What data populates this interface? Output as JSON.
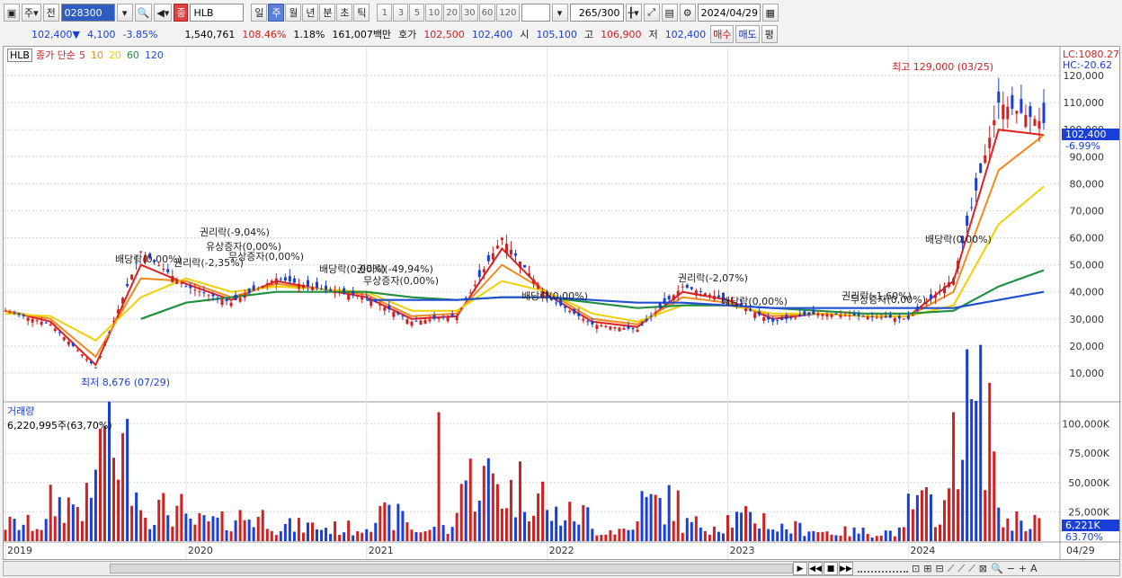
{
  "toolbar": {
    "type_label": "주",
    "prev_label": "전",
    "code": "028300",
    "name": "HLB",
    "periods": [
      "일",
      "주",
      "월",
      "년",
      "분",
      "초",
      "틱"
    ],
    "active_period": "주",
    "intervals": [
      "1",
      "3",
      "5",
      "10",
      "20",
      "30",
      "60",
      "120"
    ],
    "count": "265",
    "count_total": "/300",
    "date": "2024/04/29"
  },
  "quote": {
    "price": "102,400",
    "arrow": "▼",
    "change": "4,100",
    "change_pct": "-3.85%",
    "volume": "1,540,761",
    "turnover_pct": "108.46%",
    "rate": "1.18%",
    "amount": "161,007백만",
    "ask_label": "호가",
    "ask": "102,500",
    "bid": "102,400",
    "open_label": "시",
    "open": "105,100",
    "high_label": "고",
    "high": "106,900",
    "low_label": "저",
    "low": "102,400",
    "buy_label": "매수",
    "sell_label": "매도",
    "eval_label": "평"
  },
  "legend": {
    "stock": "HLB",
    "title": "종가 단순",
    "ma": [
      "5",
      "10",
      "20",
      "60",
      "120"
    ],
    "colors": [
      "#e02020",
      "#f08a1c",
      "#f0d000",
      "#209040",
      "#2050d0"
    ]
  },
  "scale_labels": {
    "lc": "LC:1080.27",
    "hc": "HC:-20.62",
    "price_tag": "102,400",
    "pct_tag": "-6.99%",
    "vol_tag": "6,221K",
    "vol_pct": "63.70%"
  },
  "y_price_ticks": [
    "120,000",
    "110,000",
    "100,000",
    "90,000",
    "80,000",
    "70,000",
    "60,000",
    "50,000",
    "40,000",
    "30,000",
    "20,000",
    "10,000"
  ],
  "y_volume_ticks": [
    "100,000K",
    "75,000K",
    "50,000K",
    "25,000K"
  ],
  "x_ticks": [
    "2019",
    "2020",
    "2021",
    "2022",
    "2023",
    "2024"
  ],
  "x_end_label": "04/29",
  "annotations": {
    "high": "최고 129,000 (03/25)",
    "low": "최저 8,676 (07/29)",
    "events": [
      "배당락(0,00%)",
      "권리락(-2,35%)",
      "권리락(-9,04%)",
      "유상증자(0,00%)",
      "무상증자(0,00%)",
      "배당락(0,00%)",
      "권리락(-49,94%)",
      "무상증자(0,00%)",
      "배당락(0,00%)",
      "권리락(-2,07%)",
      "배당락(0,00%)",
      "권리락(-1,60%)",
      "무상증자(0,00%)",
      "배당락(0,00%)"
    ]
  },
  "volume_legend": {
    "title": "거래량",
    "value": "6,220,995주(63,70%)"
  },
  "chart_data": {
    "type": "line",
    "x": [
      "2019-01",
      "2019-04",
      "2019-07",
      "2019-10",
      "2020-01",
      "2020-04",
      "2020-07",
      "2020-10",
      "2021-01",
      "2021-04",
      "2021-07",
      "2021-10",
      "2022-01",
      "2022-04",
      "2022-07",
      "2022-10",
      "2023-01",
      "2023-04",
      "2023-07",
      "2023-10",
      "2024-01",
      "2024-02",
      "2024-03",
      "2024-04"
    ],
    "series": [
      {
        "name": "종가",
        "values": [
          33000,
          28000,
          12000,
          55000,
          42000,
          36000,
          45000,
          41000,
          38000,
          29000,
          31000,
          60000,
          38000,
          28000,
          26000,
          42000,
          37000,
          29000,
          32000,
          31000,
          30000,
          45000,
          110000,
          102400
        ]
      },
      {
        "name": "5",
        "values": [
          33000,
          29000,
          13000,
          50000,
          43000,
          37000,
          44000,
          41000,
          38000,
          30000,
          31000,
          56000,
          39000,
          29000,
          27000,
          40000,
          37000,
          30000,
          32000,
          31000,
          31000,
          44000,
          100000,
          98000
        ]
      },
      {
        "name": "10",
        "values": [
          33000,
          30000,
          16000,
          45000,
          44000,
          38000,
          43000,
          41000,
          39000,
          31000,
          32000,
          50000,
          40000,
          30000,
          28000,
          38000,
          36000,
          31000,
          32000,
          31000,
          31000,
          40000,
          85000,
          98000
        ]
      },
      {
        "name": "20",
        "values": [
          32000,
          31000,
          22000,
          38000,
          45000,
          40000,
          42000,
          41000,
          40000,
          33000,
          33000,
          44000,
          40000,
          32000,
          29000,
          35000,
          35000,
          32000,
          32000,
          31000,
          31000,
          35000,
          65000,
          79000
        ]
      },
      {
        "name": "60",
        "values": [
          null,
          null,
          null,
          30000,
          36000,
          38000,
          40000,
          40000,
          40000,
          38000,
          37000,
          38000,
          38000,
          36000,
          34000,
          35000,
          35000,
          34000,
          33000,
          32000,
          32000,
          33000,
          42000,
          48000
        ]
      },
      {
        "name": "120",
        "values": [
          null,
          null,
          null,
          null,
          null,
          null,
          null,
          null,
          37000,
          37000,
          37000,
          38000,
          38000,
          37000,
          36000,
          36000,
          35000,
          34000,
          34000,
          34000,
          34000,
          34000,
          37000,
          40000
        ]
      }
    ],
    "ylim": [
      0,
      130000
    ]
  }
}
